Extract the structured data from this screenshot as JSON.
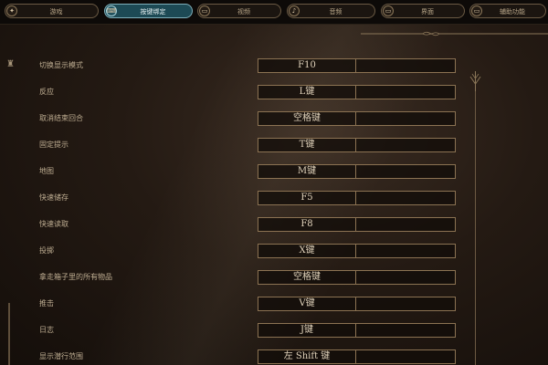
{
  "tabs": [
    {
      "label": "游戏",
      "icon": "gamepad-icon",
      "active": false
    },
    {
      "label": "按键绑定",
      "icon": "keyboard-icon",
      "active": true
    },
    {
      "label": "视频",
      "icon": "monitor-icon",
      "active": false
    },
    {
      "label": "音频",
      "icon": "speaker-icon",
      "active": false
    },
    {
      "label": "界面",
      "icon": "monitor-icon",
      "active": false
    },
    {
      "label": "辅助功能",
      "icon": "monitor-icon",
      "active": false
    }
  ],
  "bindings": [
    {
      "action": "切换显示模式",
      "key": "F10"
    },
    {
      "action": "反应",
      "key": "L键"
    },
    {
      "action": "取消结束回合",
      "key": "空格键"
    },
    {
      "action": "固定提示",
      "key": "T键"
    },
    {
      "action": "地图",
      "key": "M键"
    },
    {
      "action": "快速储存",
      "key": "F5"
    },
    {
      "action": "快速读取",
      "key": "F8"
    },
    {
      "action": "投掷",
      "key": "X键"
    },
    {
      "action": "拿走箱子里的所有物品",
      "key": "空格键"
    },
    {
      "action": "推击",
      "key": "V键"
    },
    {
      "action": "日志",
      "key": "J键"
    },
    {
      "action": "显示潜行范围",
      "key": "左 Shift 键"
    }
  ],
  "colors": {
    "accent_active": "#1d4a55",
    "box_border": "#8c7353",
    "text": "#bfae92"
  }
}
